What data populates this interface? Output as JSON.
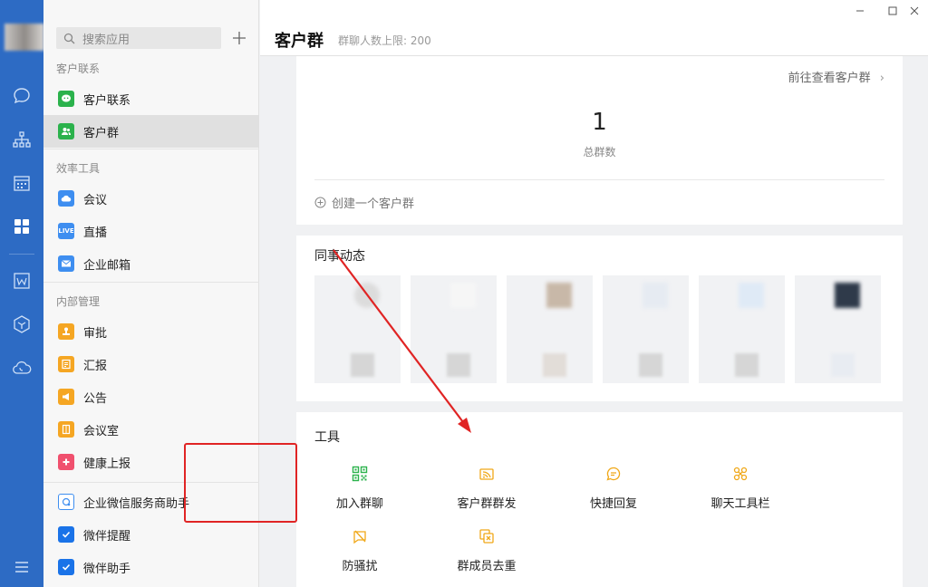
{
  "sidebar": {
    "search_placeholder": "搜索应用",
    "sections": {
      "customer": "客户联系",
      "efficiency": "效率工具",
      "internal": "内部管理"
    },
    "items": [
      {
        "label": "客户联系",
        "color": "#2bb24c"
      },
      {
        "label": "客户群",
        "color": "#2bb24c"
      },
      {
        "label": "会议",
        "color": "#3e8ef0"
      },
      {
        "label": "直播",
        "color": "#3e8ef0",
        "badge": "LIVE"
      },
      {
        "label": "企业邮箱",
        "color": "#3e8ef0"
      },
      {
        "label": "审批",
        "color": "#f5a623"
      },
      {
        "label": "汇报",
        "color": "#f5a623"
      },
      {
        "label": "公告",
        "color": "#f5a623"
      },
      {
        "label": "会议室",
        "color": "#f5a623"
      },
      {
        "label": "健康上报",
        "color": "#f0506e"
      },
      {
        "label": "企业微信服务商助手",
        "color": "#3e8ef0"
      },
      {
        "label": "微伴提醒",
        "color": "#1a73e8"
      },
      {
        "label": "微伴助手",
        "color": "#1a73e8"
      }
    ]
  },
  "header": {
    "title": "客户群",
    "subtitle": "群聊人数上限: 200"
  },
  "summary": {
    "goto_link": "前往查看客户群",
    "total_count": "1",
    "total_label": "总群数",
    "create_label": "创建一个客户群"
  },
  "colleagues": {
    "title": "同事动态",
    "thumb_colors": [
      "#e8e8e8",
      "#f4f4f4",
      "#c8b8a8",
      "#e6ebf2",
      "#dfeaf6",
      "#2f3a4a"
    ]
  },
  "tools": {
    "title": "工具",
    "accent": "#f0a818",
    "items": [
      {
        "label": "加入群聊",
        "icon": "qrcode-icon",
        "color": "#2bb24c"
      },
      {
        "label": "客户群群发",
        "icon": "broadcast-icon",
        "color": "#f0a818"
      },
      {
        "label": "快捷回复",
        "icon": "chat-bubble-icon",
        "color": "#f0a818"
      },
      {
        "label": "聊天工具栏",
        "icon": "toolbar-icon",
        "color": "#f0a818"
      },
      {
        "label": "防骚扰",
        "icon": "shield-block-icon",
        "color": "#f0a818"
      },
      {
        "label": "群成员去重",
        "icon": "dedupe-icon",
        "color": "#f0a818"
      }
    ]
  },
  "annotation_color": "#e02424"
}
